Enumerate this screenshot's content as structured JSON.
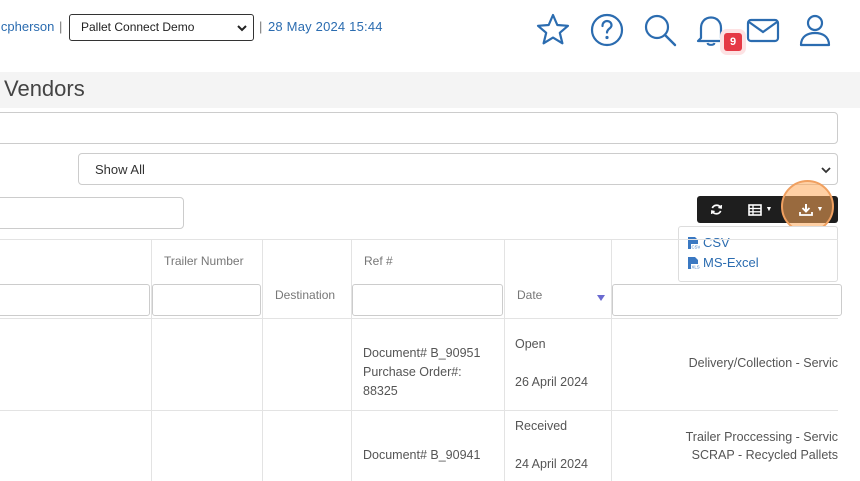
{
  "header": {
    "user_name": "lcpherson",
    "separator": "|",
    "company_selected": "Pallet Connect Demo",
    "datetime": "28 May 2024 15:44",
    "notification_count": "9",
    "icons": [
      "star-icon",
      "help-icon",
      "search-icon",
      "bell-icon",
      "mail-icon",
      "user-icon"
    ],
    "accent_color": "#2b6cb0",
    "badge_color": "#e53945"
  },
  "page": {
    "title": "Vendors"
  },
  "filters": {
    "show_selected": "Show All"
  },
  "toolbar": {
    "buttons": [
      "refresh-icon",
      "columns-icon",
      "download-icon"
    ],
    "export_menu": [
      "CSV",
      "MS-Excel"
    ]
  },
  "table": {
    "headers": {
      "trailer_number": "Trailer Number",
      "destination": "Destination",
      "ref": "Ref #",
      "date": "Date"
    },
    "rows": [
      {
        "ref_doc": "Document# B_90951",
        "ref_po_label": "Purchase Order#:",
        "ref_po_value": "88325",
        "status": "Open",
        "date": "26 April 2024",
        "service_1": "Delivery/Collection - Servic"
      },
      {
        "ref_doc": "Document# B_90941",
        "status": "Received",
        "date": "24 April 2024",
        "service_1": "Trailer Proccessing - Servic",
        "service_2": "SCRAP - Recycled Pallets"
      }
    ]
  }
}
